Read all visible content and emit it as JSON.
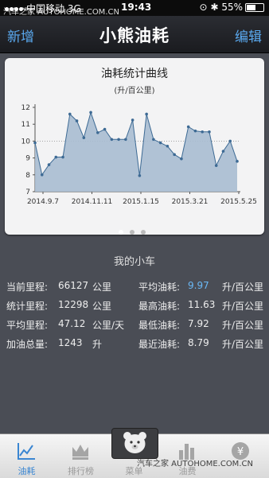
{
  "status_bar": {
    "carrier": "中国移动",
    "network": "3G",
    "time": "19:43",
    "battery": "55%"
  },
  "nav": {
    "left_label": "新增",
    "title": "小熊油耗",
    "right_label": "编辑"
  },
  "watermark": {
    "top": "汽车之家 AUTOHOME.COM.CN",
    "bottom": "汽车之家 AUTOHOME.COM.CN"
  },
  "chart_data": {
    "type": "area",
    "title": "油耗统计曲线",
    "subtitle": "(升/百公里)",
    "xlabel": "",
    "ylabel": "",
    "x_ticks": [
      "2014.9.7",
      "2014.11.11",
      "2015.1.15",
      "2015.3.21",
      "2015.5.25"
    ],
    "y_ticks": [
      7,
      8,
      9,
      10,
      11,
      12
    ],
    "ylim": [
      7,
      12
    ],
    "reference_line": 10,
    "series": [
      {
        "values": [
          9.9,
          8.0,
          8.6,
          9.05,
          9.05,
          11.6,
          11.2,
          10.2,
          11.7,
          10.5,
          10.7,
          10.1,
          10.1,
          10.1,
          11.25,
          7.95,
          11.6,
          10.1,
          9.9,
          9.7,
          9.2,
          8.95,
          10.85,
          10.6,
          10.55,
          10.55,
          8.55,
          9.4,
          10.0,
          8.8
        ]
      }
    ],
    "fill_color": "#a8bdd2",
    "line_color": "#3d6a94",
    "grid": true
  },
  "pager": {
    "pages": 3,
    "active": 0
  },
  "my_car": {
    "title": "我的小车",
    "left": [
      {
        "label": "当前里程:",
        "value": "66127",
        "unit": "公里"
      },
      {
        "label": "统计里程:",
        "value": "12298",
        "unit": "公里"
      },
      {
        "label": "平均里程:",
        "value": "47.12",
        "unit": "公里/天"
      },
      {
        "label": "加油总量:",
        "value": "1243",
        "unit": "升"
      }
    ],
    "right": [
      {
        "label": "平均油耗:",
        "value": "9.97",
        "unit": "升/百公里"
      },
      {
        "label": "最高油耗:",
        "value": "11.63",
        "unit": "升/百公里"
      },
      {
        "label": "最低油耗:",
        "value": "7.92",
        "unit": "升/百公里"
      },
      {
        "label": "最近油耗:",
        "value": "8.79",
        "unit": "升/百公里"
      }
    ],
    "highlight_color": "#6ab8f5"
  },
  "tabs": [
    {
      "label": "油耗",
      "icon": "line-chart-icon",
      "active": true
    },
    {
      "label": "排行榜",
      "icon": "crown-icon",
      "active": false
    },
    {
      "label": "菜单",
      "icon": "bear-icon",
      "active": false
    },
    {
      "label": "油费",
      "icon": "bar-chart-icon",
      "active": false
    },
    {
      "label": "",
      "icon": "yen-coin-icon",
      "active": false
    }
  ]
}
